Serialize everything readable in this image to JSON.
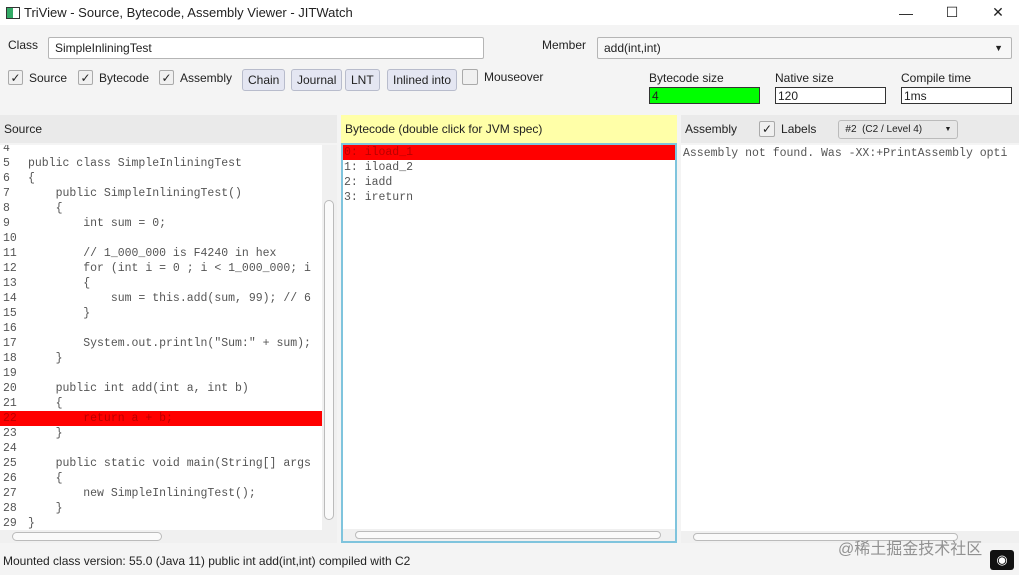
{
  "window": {
    "title": "TriView - Source, Bytecode, Assembly Viewer - JITWatch",
    "minimize": "—",
    "maximize": "☐",
    "close": "✕"
  },
  "toolbar": {
    "class_label": "Class",
    "class_value": "SimpleInliningTest",
    "member_label": "Member",
    "member_value": "add(int,int)",
    "checks": [
      {
        "label": "Source",
        "checked": true
      },
      {
        "label": "Bytecode",
        "checked": true
      },
      {
        "label": "Assembly",
        "checked": true
      }
    ],
    "buttons": [
      "Chain",
      "Journal",
      "LNT",
      "Inlined into"
    ],
    "mouseover": {
      "label": "Mouseover",
      "checked": false
    },
    "bytecode_size": {
      "label": "Bytecode size",
      "value": "4",
      "color": "#00ff00"
    },
    "native_size": {
      "label": "Native size",
      "value": "120"
    },
    "compile_time": {
      "label": "Compile time",
      "value": "1ms"
    }
  },
  "source": {
    "header": "Source",
    "lines": [
      {
        "n": "4",
        "text": ""
      },
      {
        "n": "5",
        "text": "public class SimpleInliningTest"
      },
      {
        "n": "6",
        "text": "{"
      },
      {
        "n": "7",
        "text": "    public SimpleInliningTest()"
      },
      {
        "n": "8",
        "text": "    {"
      },
      {
        "n": "9",
        "text": "        int sum = 0;"
      },
      {
        "n": "10",
        "text": ""
      },
      {
        "n": "11",
        "text": "        // 1_000_000 is F4240 in hex"
      },
      {
        "n": "12",
        "text": "        for (int i = 0 ; i < 1_000_000; i"
      },
      {
        "n": "13",
        "text": "        {"
      },
      {
        "n": "14",
        "text": "            sum = this.add(sum, 99); // 6"
      },
      {
        "n": "15",
        "text": "        }"
      },
      {
        "n": "16",
        "text": ""
      },
      {
        "n": "17",
        "text": "        System.out.println(\"Sum:\" + sum);"
      },
      {
        "n": "18",
        "text": "    }"
      },
      {
        "n": "19",
        "text": ""
      },
      {
        "n": "20",
        "text": "    public int add(int a, int b)"
      },
      {
        "n": "21",
        "text": "    {"
      },
      {
        "n": "22",
        "text": "        return a + b;",
        "highlight": true
      },
      {
        "n": "23",
        "text": "    }"
      },
      {
        "n": "24",
        "text": ""
      },
      {
        "n": "25",
        "text": "    public static void main(String[] args"
      },
      {
        "n": "26",
        "text": "    {"
      },
      {
        "n": "27",
        "text": "        new SimpleInliningTest();"
      },
      {
        "n": "28",
        "text": "    }"
      },
      {
        "n": "29",
        "text": "}"
      }
    ]
  },
  "bytecode": {
    "header": "Bytecode (double click for JVM spec)",
    "header_color": "#ffffa8",
    "lines": [
      {
        "text": "0: iload_1",
        "highlight": true
      },
      {
        "text": "1: iload_2"
      },
      {
        "text": "2: iadd"
      },
      {
        "text": "3: ireturn"
      }
    ]
  },
  "assembly": {
    "header": "Assembly",
    "labels_label": "Labels",
    "labels_checked": true,
    "compilation": "#2  (C2 / Level 4)",
    "message": "Assembly not found. Was -XX:+PrintAssembly opti"
  },
  "status": {
    "text": "Mounted class version: 55.0 (Java 11) public int add(int,int) compiled with C2"
  },
  "watermark": "@稀土掘金技术社区",
  "highlight_color": "#ff0000"
}
